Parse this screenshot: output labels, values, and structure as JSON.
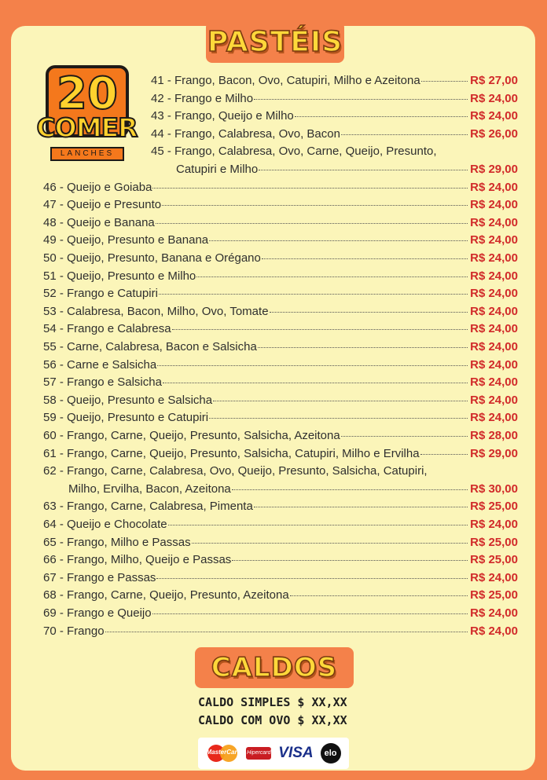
{
  "header": {
    "title": "PASTÉIS"
  },
  "logo": {
    "number": "20",
    "word": "COMER",
    "sub": "LANCHES"
  },
  "items": [
    {
      "text": "41 - Frango, Bacon, Ovo, Catupiri, Milho e Azeitona",
      "price": "R$ 27,00"
    },
    {
      "text": "42 - Frango e Milho",
      "price": "R$ 24,00"
    },
    {
      "text": "43 - Frango, Queijo e Milho",
      "price": "R$ 24,00"
    },
    {
      "text": "44 - Frango, Calabresa, Ovo, Bacon",
      "price": "R$ 26,00"
    },
    {
      "text": "45 - Frango, Calabresa, Ovo, Carne, Queijo, Presunto,",
      "text2": "Catupiri e Milho",
      "price": "R$ 29,00"
    },
    {
      "text": "46 - Queijo e Goiaba",
      "price": "R$ 24,00"
    },
    {
      "text": "47 - Queijo e Presunto",
      "price": "R$ 24,00"
    },
    {
      "text": "48 - Queijo e Banana",
      "price": "R$ 24,00"
    },
    {
      "text": "49 - Queijo, Presunto e Banana",
      "price": "R$ 24,00"
    },
    {
      "text": "50 - Queijo, Presunto, Banana e Orégano",
      "price": "R$ 24,00"
    },
    {
      "text": "51 - Queijo, Presunto e Milho",
      "price": "R$ 24,00"
    },
    {
      "text": "52 - Frango e Catupiri",
      "price": "R$ 24,00"
    },
    {
      "text": "53 - Calabresa, Bacon, Milho, Ovo, Tomate",
      "price": "R$ 24,00"
    },
    {
      "text": "54 - Frango e Calabresa",
      "price": "R$ 24,00"
    },
    {
      "text": "55 - Carne, Calabresa, Bacon e Salsicha",
      "price": "R$ 24,00"
    },
    {
      "text": "56 - Carne e Salsicha",
      "price": "R$ 24,00"
    },
    {
      "text": "57 - Frango e Salsicha",
      "price": "R$ 24,00"
    },
    {
      "text": "58 - Queijo, Presunto e Salsicha",
      "price": "R$ 24,00"
    },
    {
      "text": "59 - Queijo, Presunto e Catupiri",
      "price": "R$ 24,00"
    },
    {
      "text": "60 - Frango, Carne, Queijo, Presunto, Salsicha, Azeitona",
      "price": "R$ 28,00"
    },
    {
      "text": "61 - Frango, Carne, Queijo, Presunto, Salsicha, Catupiri, Milho e Ervilha",
      "price": "R$ 29,00"
    },
    {
      "text": "62 - Frango, Carne, Calabresa, Ovo, Queijo, Presunto, Salsicha, Catupiri,",
      "text2": "Milho, Ervilha, Bacon, Azeitona",
      "price": "R$ 30,00"
    },
    {
      "text": "63 - Frango, Carne, Calabresa, Pimenta",
      "price": "R$ 25,00"
    },
    {
      "text": "64 - Queijo e Chocolate",
      "price": "R$ 24,00"
    },
    {
      "text": "65 - Frango, Milho e Passas",
      "price": "R$ 25,00"
    },
    {
      "text": "66 - Frango, Milho, Queijo e Passas",
      "price": "R$ 25,00"
    },
    {
      "text": "67 - Frango e Passas",
      "price": "R$ 24,00"
    },
    {
      "text": "68 - Frango, Carne, Queijo, Presunto, Azeitona",
      "price": "R$ 25,00"
    },
    {
      "text": "69 - Frango e Queijo",
      "price": "R$ 24,00"
    },
    {
      "text": "70 - Frango",
      "price": "R$ 24,00"
    }
  ],
  "caldos": {
    "title": "CALDOS",
    "items": [
      {
        "text": "CALDO SIMPLES  $ XX,XX"
      },
      {
        "text": "CALDO COM OVO  $ XX,XX"
      }
    ]
  },
  "payments": {
    "mastercard": "MasterCard",
    "hipercard": "Hipercard",
    "visa": "VISA",
    "elo": "elo"
  }
}
